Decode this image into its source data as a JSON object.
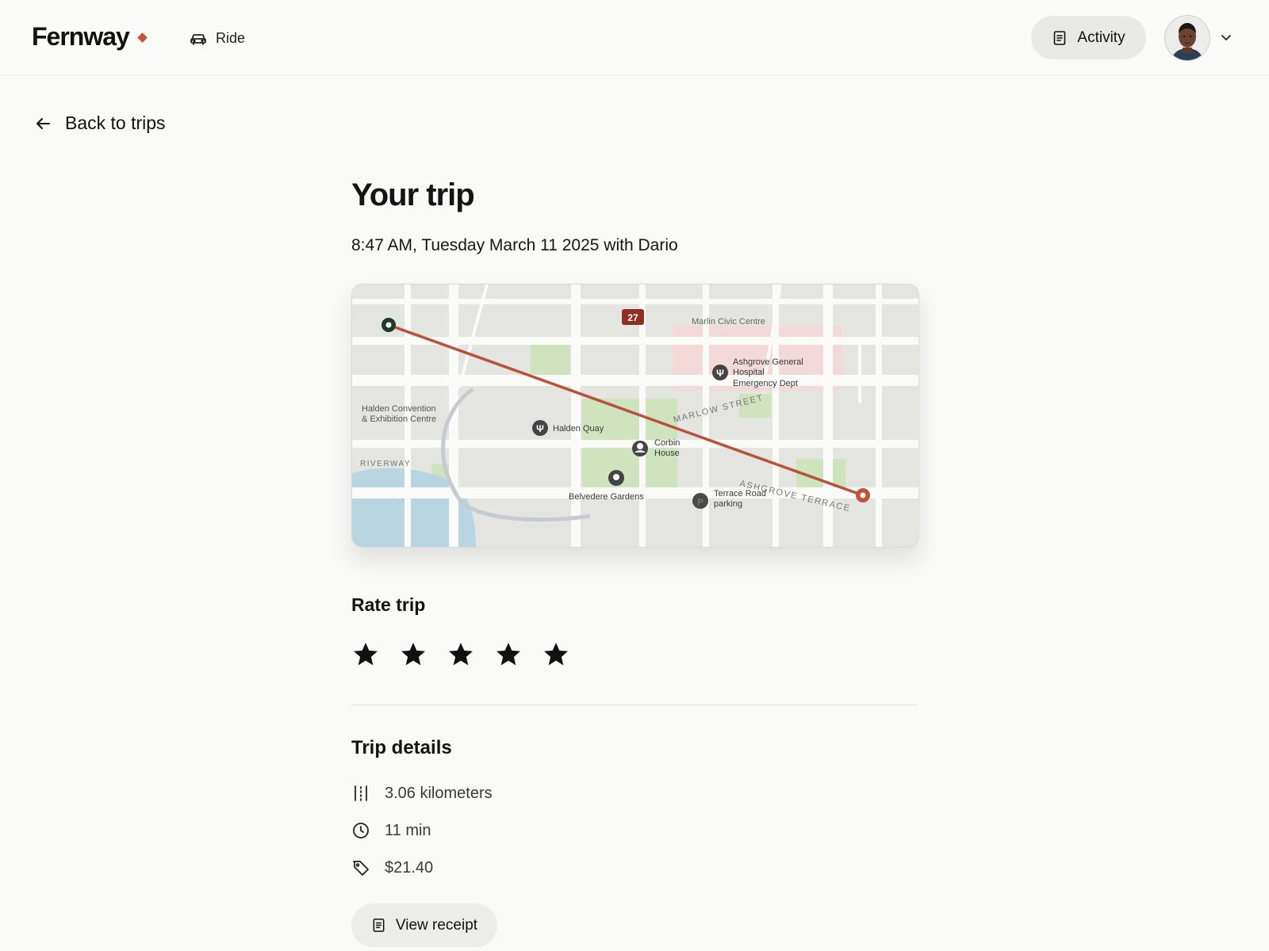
{
  "header": {
    "logo": "Fernway",
    "nav_ride": "Ride",
    "activity_label": "Activity"
  },
  "back_link": "Back to trips",
  "trip": {
    "title": "Your trip",
    "subtitle": "8:47 AM, Tuesday March 11 2025 with Dario"
  },
  "map": {
    "labels": {
      "route_badge": "27",
      "civic_centre": "Marlin Civic Centre",
      "hospital_1": "Ashgrove General",
      "hospital_2": "Hospital",
      "hospital_3": "Emergency Dept",
      "convention_1": "Halden Convention",
      "convention_2": "& Exhibition Centre",
      "quay": "Halden Quay",
      "corbin_1": "Corbin",
      "corbin_2": "House",
      "riverway": "RIVERWAY",
      "gardens": "Belvedere Gardens",
      "parking_1": "Terrace Road",
      "parking_2": "parking",
      "marlow": "MARLOW STREET",
      "ashgrove_terrace": "ASHGROVE TERRACE"
    },
    "colors": {
      "route": "#b8523c",
      "start_marker": "#1f3a2f",
      "end_marker": "#c0533c",
      "park": "#cfe3be",
      "water": "#b9d5e2",
      "hospital_zone": "#f3d9d9"
    }
  },
  "rating": {
    "title": "Rate trip",
    "max_stars": 5
  },
  "details": {
    "title": "Trip details",
    "distance": "3.06 kilometers",
    "duration": "11 min",
    "price": "$21.40"
  },
  "receipt_label": "View receipt"
}
